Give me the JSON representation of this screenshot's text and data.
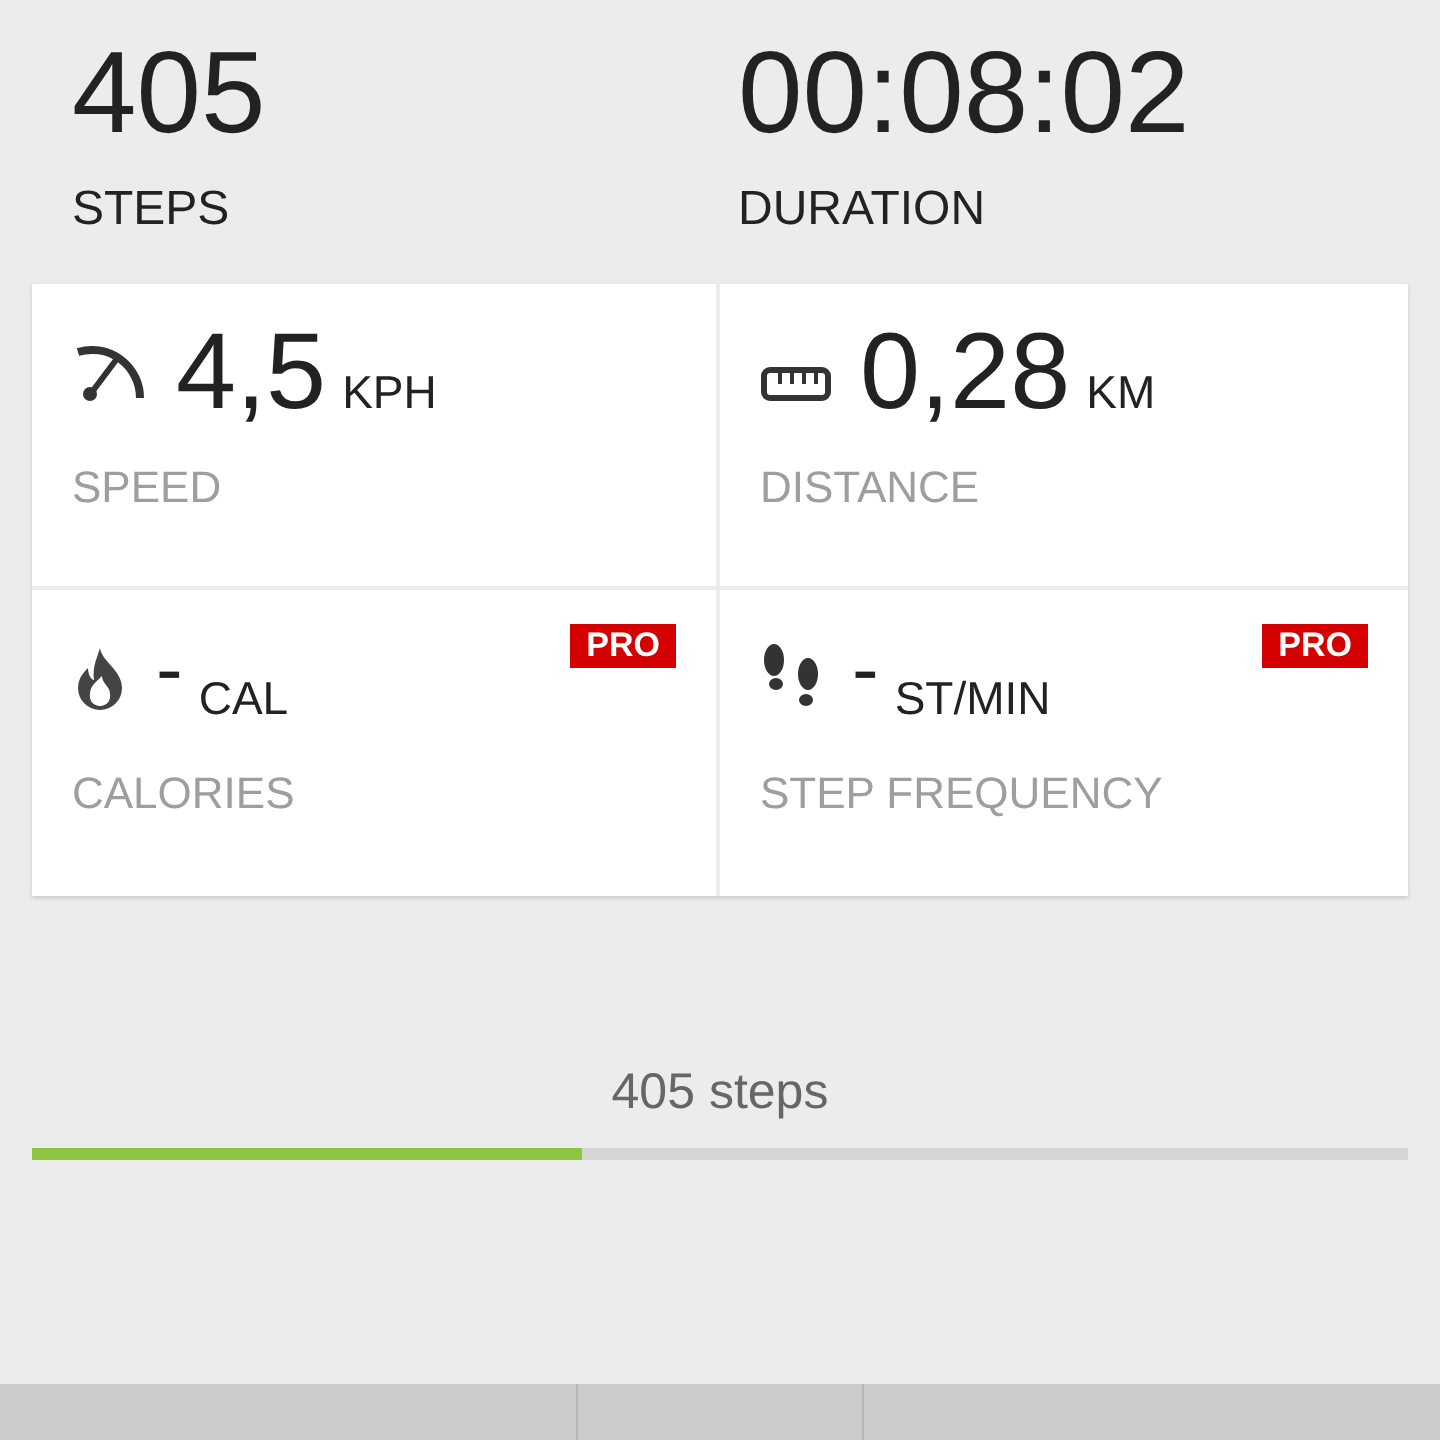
{
  "summary": [
    {
      "value": "405",
      "label": "STEPS"
    },
    {
      "value": "00:08:02",
      "label": "DURATION"
    }
  ],
  "metrics": [
    {
      "kind": "speed",
      "value": "4,5",
      "unit": "KPH",
      "label": "SPEED"
    },
    {
      "kind": "distance",
      "value": "0,28",
      "unit": "KM",
      "label": "DISTANCE"
    },
    {
      "kind": "calories",
      "value": "-",
      "unit": "CAL",
      "label": "CALORIES",
      "badge": "PRO"
    },
    {
      "kind": "cadence",
      "value": "-",
      "unit": "ST/MIN",
      "label": "STEP FREQUENCY",
      "badge": "PRO"
    }
  ],
  "progress": {
    "label": "405 steps",
    "level": 0.4
  }
}
